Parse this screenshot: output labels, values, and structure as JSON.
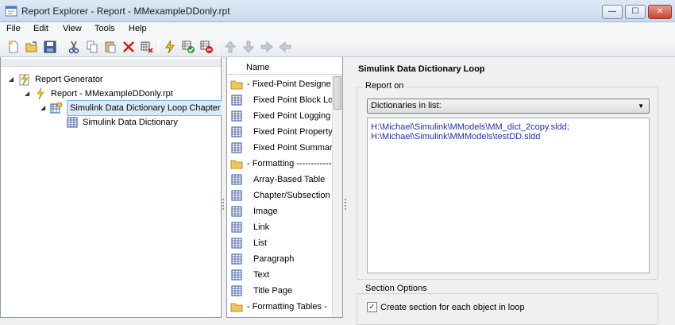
{
  "window": {
    "title": "Report Explorer - Report - MMexampleDDonly.rpt",
    "controls": {
      "minimize": "—",
      "maximize": "☐",
      "close": "✕"
    }
  },
  "menu": [
    "File",
    "Edit",
    "View",
    "Tools",
    "Help"
  ],
  "toolbar": {
    "icons": [
      "new-report-icon",
      "open-icon",
      "save-icon",
      "cut-icon",
      "copy-icon",
      "paste-icon",
      "delete-icon",
      "add-component-icon",
      "run-report-icon",
      "enable-icon",
      "disable-icon",
      "move-up-icon",
      "move-down-icon",
      "demote-icon",
      "promote-icon"
    ]
  },
  "tree": {
    "items": [
      {
        "label": "Report Generator",
        "toggle": "◢",
        "icon": "report-generator-icon"
      },
      {
        "label": "Report - MMexampleDDonly.rpt",
        "toggle": "◢",
        "icon": "report-icon"
      },
      {
        "label": "Simulink Data Dictionary Loop Chapter -",
        "toggle": "◢",
        "icon": "loop-component-icon",
        "selected": true
      },
      {
        "label": "Simulink Data Dictionary",
        "toggle": "",
        "icon": "component-icon"
      }
    ]
  },
  "components": {
    "header": "Name",
    "rows": [
      {
        "label": "-  Fixed-Point Designe",
        "type": "folder"
      },
      {
        "label": "Fixed Point Block Loo",
        "type": "component"
      },
      {
        "label": "Fixed Point Logging",
        "type": "component"
      },
      {
        "label": "Fixed Point Property",
        "type": "component"
      },
      {
        "label": "Fixed Point Summary",
        "type": "component"
      },
      {
        "label": "-  Formatting  -------------",
        "type": "folder"
      },
      {
        "label": "Array-Based Table",
        "type": "component"
      },
      {
        "label": "Chapter/Subsection",
        "type": "component"
      },
      {
        "label": "Image",
        "type": "component"
      },
      {
        "label": "Link",
        "type": "component"
      },
      {
        "label": "List",
        "type": "component"
      },
      {
        "label": "Paragraph",
        "type": "component"
      },
      {
        "label": "Text",
        "type": "component"
      },
      {
        "label": "Title Page",
        "type": "component"
      },
      {
        "label": "-  Formatting Tables  -",
        "type": "folder"
      }
    ]
  },
  "properties": {
    "title": "Simulink Data Dictionary Loop",
    "report_on_legend": "Report on",
    "report_on_value": "Dictionaries in list:",
    "dictionary_list": [
      "H:\\Michael\\Simulink\\MModels\\MM_dict_2copy.sldd;",
      "H:\\Michael\\Simulink\\MMModels\\testDD.sldd"
    ],
    "section_options_legend": "Section Options",
    "create_section_label": "Create section for each object in loop",
    "create_section_checked": true,
    "check_mark": "✓",
    "dropdown_arrow": "▼"
  },
  "colors": {
    "list_text": "#1f2fb4",
    "selection": "#dbeaf9"
  }
}
